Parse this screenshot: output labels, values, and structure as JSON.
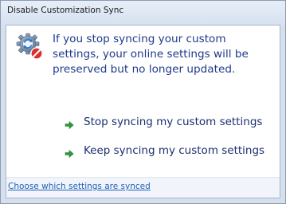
{
  "window": {
    "title": "Disable Customization Sync"
  },
  "message": {
    "icon": "sync-disabled-icon",
    "text": "If you stop syncing your custom settings, your online settings will be preserved but no longer updated."
  },
  "commands": [
    {
      "label": "Stop syncing my custom settings",
      "icon": "green-arrow-icon"
    },
    {
      "label": "Keep syncing my custom settings",
      "icon": "green-arrow-icon"
    }
  ],
  "footer": {
    "link": "Choose which settings are synced"
  },
  "colors": {
    "message_text": "#1e3a8a",
    "command_text": "#1b2f70",
    "link": "#2060b8",
    "arrow": "#2e9a3a",
    "stop_badge": "#d9302c"
  }
}
